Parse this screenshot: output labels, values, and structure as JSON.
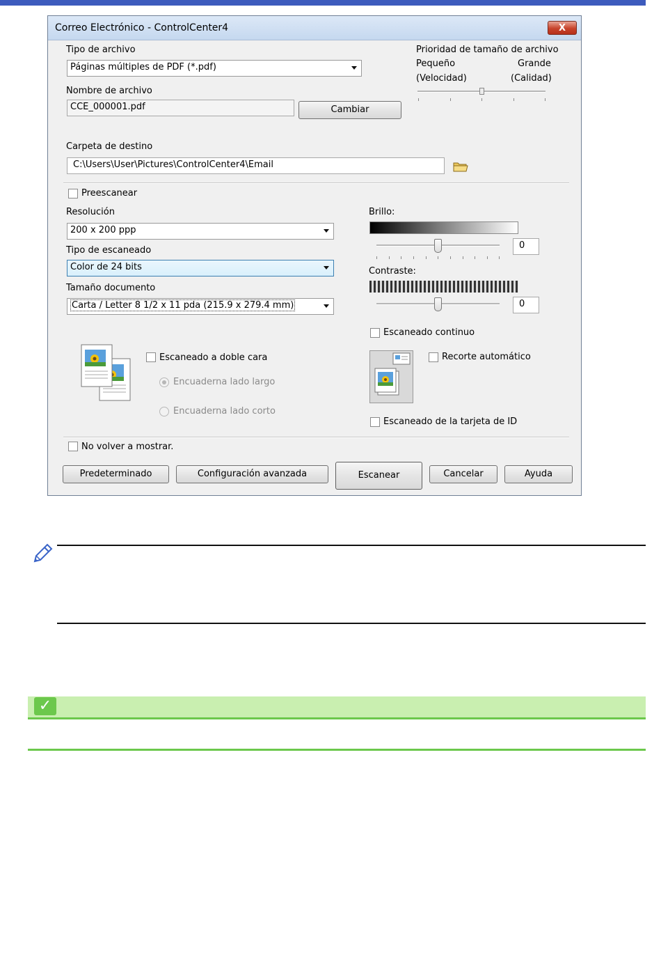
{
  "dialog": {
    "title": "Correo Electrónico - ControlCenter4",
    "close_glyph": "X",
    "file_type": {
      "label": "Tipo de archivo",
      "value": "Páginas múltiples de PDF (*.pdf)"
    },
    "file_size_priority": {
      "label": "Prioridad de tamaño de archivo",
      "small": "Pequeño",
      "large": "Grande",
      "small_sub": "(Velocidad)",
      "large_sub": "(Calidad)",
      "level": 0.5
    },
    "file_name": {
      "label": "Nombre de archivo",
      "value": "CCE_000001.pdf",
      "change_button": "Cambiar"
    },
    "destination": {
      "label": "Carpeta de destino",
      "value": "C:\\Users\\User\\Pictures\\ControlCenter4\\Email",
      "icon": "folder-icon"
    },
    "prescan": {
      "label": "Preescanear",
      "checked": false
    },
    "resolution": {
      "label": "Resolución",
      "value": "200 x 200 ppp"
    },
    "scan_type": {
      "label": "Tipo de escaneado",
      "value": "Color de 24 bits"
    },
    "document_size": {
      "label": "Tamaño documento",
      "value": "Carta / Letter 8 1/2 x 11 pda (215.9 x 279.4 mm)"
    },
    "brightness": {
      "label": "Brillo:",
      "value": "0",
      "level": 0.5
    },
    "contrast": {
      "label": "Contraste:",
      "value": "0",
      "level": 0.5
    },
    "continuous_scan": {
      "label": "Escaneado continuo",
      "checked": false
    },
    "duplex": {
      "label": "Escaneado a doble cara",
      "checked": false,
      "long_edge": "Encuaderna lado largo",
      "short_edge": "Encuaderna lado corto",
      "icon": "duplex-pages-icon"
    },
    "auto_crop": {
      "label": "Recorte automático",
      "checked": false,
      "icon": "auto-crop-icon"
    },
    "id_card": {
      "label": "Escaneado de la tarjeta de ID",
      "checked": false
    },
    "dont_show": {
      "label": "No volver a mostrar.",
      "checked": false
    },
    "buttons": {
      "default": "Predeterminado",
      "advanced": "Configuración avanzada",
      "scan": "Escanear",
      "cancel": "Cancelar",
      "help": "Ayuda"
    }
  },
  "note": {
    "icon": "pencil-icon"
  },
  "related_info": {
    "icon": "checkmark-icon",
    "glyph": "✓"
  },
  "colors": {
    "header_bar": "#3d5bbd",
    "tip_fill": "#c9efb0",
    "tip_line": "#6cc84c"
  }
}
